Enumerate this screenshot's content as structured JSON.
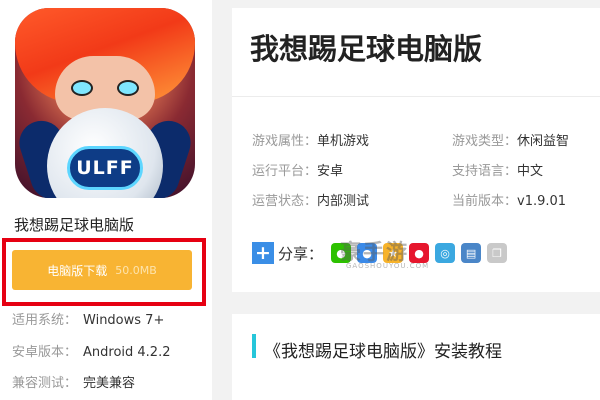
{
  "app": {
    "name": "我想踢足球电脑版",
    "icon_badge": "ULFF"
  },
  "download": {
    "label": "电脑版下载",
    "size": "50.0MB"
  },
  "specs": [
    {
      "label": "适用系统：",
      "value": "Windows 7+"
    },
    {
      "label": "安卓版本：",
      "value": "Android 4.2.2"
    },
    {
      "label": "兼容测试：",
      "value": "完美兼容"
    }
  ],
  "header": {
    "title": "我想踢足球电脑版"
  },
  "attributes": [
    {
      "label": "游戏属性：",
      "value": "单机游戏"
    },
    {
      "label": "游戏类型：",
      "value": "休闲益智"
    },
    {
      "label": "运行平台：",
      "value": "安卓"
    },
    {
      "label": "支持语言：",
      "value": "中文"
    },
    {
      "label": "运营状态：",
      "value": "内部测试"
    },
    {
      "label": "当前版本：",
      "value": "v1.9.01"
    }
  ],
  "share": {
    "label": "分享：",
    "watermark": "豪手游",
    "watermark_sub": "GAOSHOUYOU.COM",
    "icons": [
      "wechat-icon",
      "qq-icon",
      "qzone-icon",
      "weibo-icon",
      "tencent-weibo-icon",
      "print-icon",
      "copy-icon"
    ]
  },
  "tutorial": {
    "title": "《我想踢足球电脑版》安装教程"
  },
  "colors": {
    "download_button": "#f8b433",
    "highlight_frame": "#e60012",
    "share_plus": "#3a8ee6",
    "tutorial_bar": "#26c6da"
  }
}
